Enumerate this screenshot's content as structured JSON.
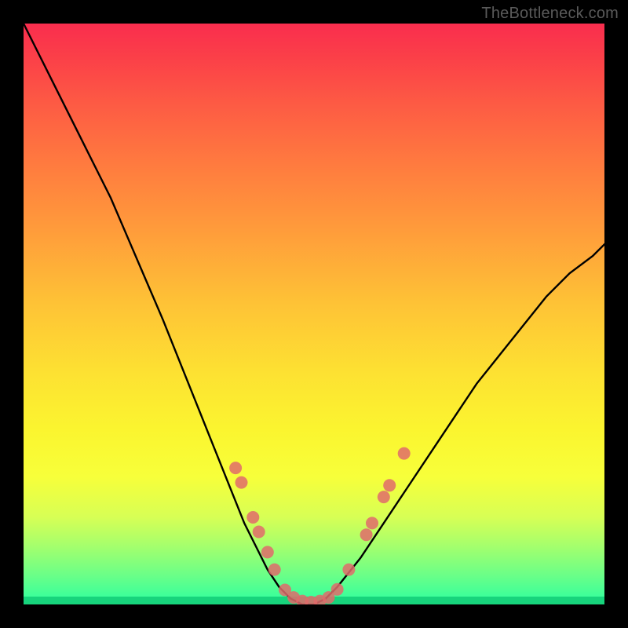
{
  "watermark": "TheBottleneck.com",
  "colors": {
    "frame": "#000000",
    "gradient_top": "#f92d4e",
    "gradient_bottom": "#2cffa0",
    "bottom_band": "#17d47c",
    "curve": "#000000",
    "markers": "#e06b6b"
  },
  "chart_data": {
    "type": "line",
    "title": "",
    "xlabel": "",
    "ylabel": "",
    "xlim": [
      0,
      100
    ],
    "ylim": [
      0,
      100
    ],
    "grid": false,
    "series": [
      {
        "name": "bottleneck-curve",
        "x": [
          0,
          3,
          6,
          9,
          12,
          15,
          18,
          21,
          24,
          26,
          28,
          30,
          32,
          34,
          36,
          38,
          40,
          42,
          44,
          46,
          48,
          50,
          52,
          54,
          58,
          62,
          66,
          70,
          74,
          78,
          82,
          86,
          90,
          94,
          98,
          100
        ],
        "y": [
          100,
          94,
          88,
          82,
          76,
          70,
          63,
          56,
          49,
          44,
          39,
          34,
          29,
          24,
          19,
          14,
          10,
          6,
          3,
          1,
          0,
          0,
          1,
          3,
          8,
          14,
          20,
          26,
          32,
          38,
          43,
          48,
          53,
          57,
          60,
          62
        ]
      }
    ],
    "markers": {
      "name": "highlighted-points",
      "points": [
        {
          "x": 36.5,
          "y": 23.5
        },
        {
          "x": 37.5,
          "y": 21.0
        },
        {
          "x": 39.5,
          "y": 15.0
        },
        {
          "x": 40.5,
          "y": 12.5
        },
        {
          "x": 42.0,
          "y": 9.0
        },
        {
          "x": 43.2,
          "y": 6.0
        },
        {
          "x": 45.0,
          "y": 2.5
        },
        {
          "x": 46.5,
          "y": 1.2
        },
        {
          "x": 48.0,
          "y": 0.6
        },
        {
          "x": 49.5,
          "y": 0.4
        },
        {
          "x": 51.0,
          "y": 0.6
        },
        {
          "x": 52.5,
          "y": 1.2
        },
        {
          "x": 54.0,
          "y": 2.6
        },
        {
          "x": 56.0,
          "y": 6.0
        },
        {
          "x": 59.0,
          "y": 12.0
        },
        {
          "x": 60.0,
          "y": 14.0
        },
        {
          "x": 62.0,
          "y": 18.5
        },
        {
          "x": 63.0,
          "y": 20.5
        },
        {
          "x": 65.5,
          "y": 26.0
        }
      ]
    }
  }
}
